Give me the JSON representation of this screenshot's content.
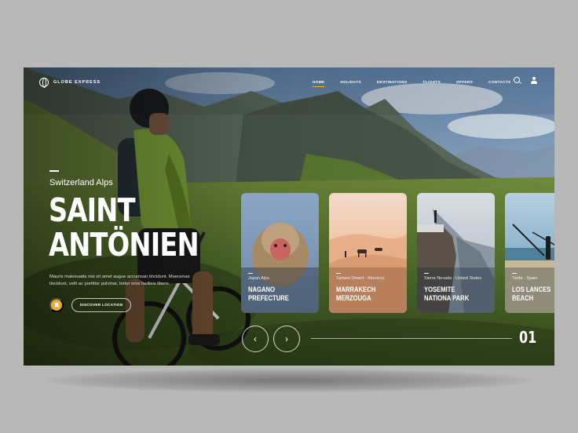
{
  "nav": {
    "logo_text": "GLOBE EXPRESS",
    "menu": [
      {
        "label": "HOME",
        "active": true
      },
      {
        "label": "HOLIDAYS",
        "active": false
      },
      {
        "label": "DESTINATIONS",
        "active": false
      },
      {
        "label": "FLIGHTS",
        "active": false
      },
      {
        "label": "OFFERS",
        "active": false
      },
      {
        "label": "CONTACTS",
        "active": false
      }
    ],
    "icons": [
      "search-icon",
      "user-icon"
    ]
  },
  "hero": {
    "subtitle": "Switzerland Alps",
    "title_line1": "SAINT",
    "title_line2": "ANTÖNIEN",
    "description": "Mauris malesuada nisi sit amet augue accumsan tincidunt. Maecenas tincidunt, velit ac porttitor pulvinar, tortor eros facilisis libero.",
    "bookmark_icon": "bookmark-icon",
    "discover_label": "DISCOVER LOCATION"
  },
  "cards": [
    {
      "subtitle": "Japan Alps",
      "title": "NAGANO PREFECTURE"
    },
    {
      "subtitle": "Sahara Desert - Morocco",
      "title": "MARRAKECH MERZOUGA"
    },
    {
      "subtitle": "Sierra Nevada - United States",
      "title": "YOSEMITE NATIONA PARK"
    },
    {
      "subtitle": "Tarifa - Spain",
      "title": "LOS LANCES BEACH"
    }
  ],
  "slider": {
    "prev_icon": "‹",
    "next_icon": "›",
    "counter": "01"
  },
  "colors": {
    "accent": "#f0ad2e"
  }
}
